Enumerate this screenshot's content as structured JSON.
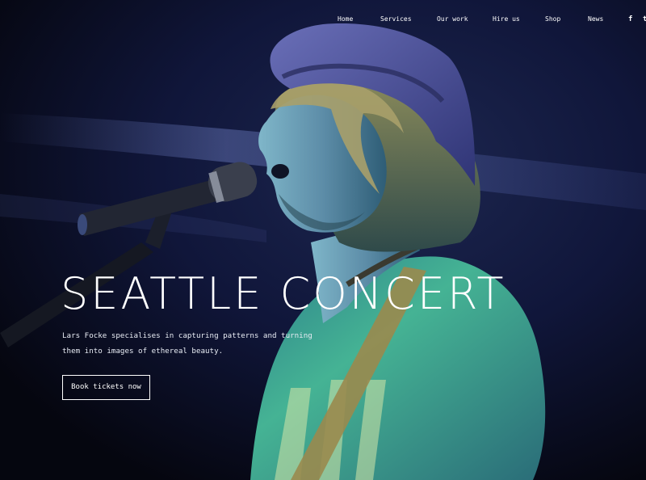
{
  "nav": {
    "items": [
      {
        "label": "Home"
      },
      {
        "label": "Services"
      },
      {
        "label": "Our work"
      },
      {
        "label": "Hire us"
      },
      {
        "label": "Shop"
      },
      {
        "label": "News"
      }
    ],
    "social": [
      {
        "icon": "facebook-icon",
        "glyph": "f"
      },
      {
        "icon": "twitter-icon",
        "glyph": "t"
      }
    ]
  },
  "hero": {
    "title": "SEATTLE CONCERT",
    "description": "Lars Focke specialises in capturing patterns and turning them into images of ethereal beauty.",
    "cta_label": "Book tickets now",
    "image": "concert-singer-photo"
  },
  "colors": {
    "background": "#0a0d1c",
    "stage_light": "#3a4a8a",
    "shirt": "#3fa88e",
    "hat": "#4a4f9a",
    "text": "#ffffff"
  }
}
